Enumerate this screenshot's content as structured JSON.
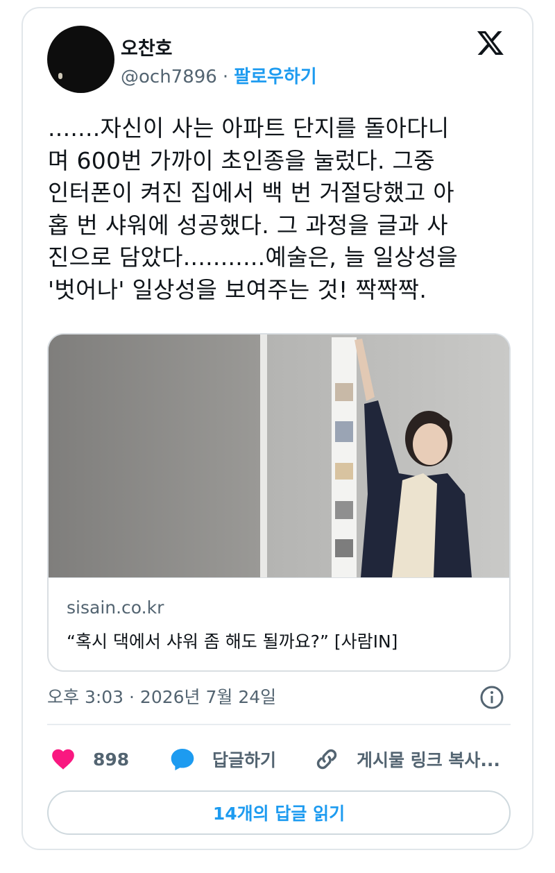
{
  "tweet": {
    "author_name": "오찬호",
    "handle": "@och7896",
    "separator": "·",
    "follow_label": "팔로우하기",
    "text": ".......자신이 사는 아파트 단지를 돌아다니\n며 600번 가까이 초인종을 눌렀다. 그중\n인터폰이 켜진 집에서 백 번 거절당했고 아\n홉 번 샤워에 성공했다. 그 과정을 글과 사\n진으로 담았다...........예술은, 늘 일상성을\n'벗어나' 일상성을 보여주는 것! 짝짝짝.",
    "timestamp": "오후 3:03 · 2026년 7월 24일"
  },
  "link_card": {
    "domain": "sisain.co.kr",
    "title": "“혹시 댁에서 샤워 좀 해도 될까요?” [사람IN]"
  },
  "actions": {
    "like_count": "898",
    "reply_label": "답글하기",
    "copy_label": "게시물 링크 복사..."
  },
  "read_replies_label": "14개의 답글 읽기",
  "icons": {
    "logo": "x-logo-icon",
    "like": "heart-icon",
    "reply": "speech-bubble-icon",
    "copy": "link-icon",
    "info": "info-icon"
  },
  "colors": {
    "accent": "#1d9bf0",
    "like": "#f91880",
    "text": "#0f1419",
    "secondary": "#536471"
  }
}
